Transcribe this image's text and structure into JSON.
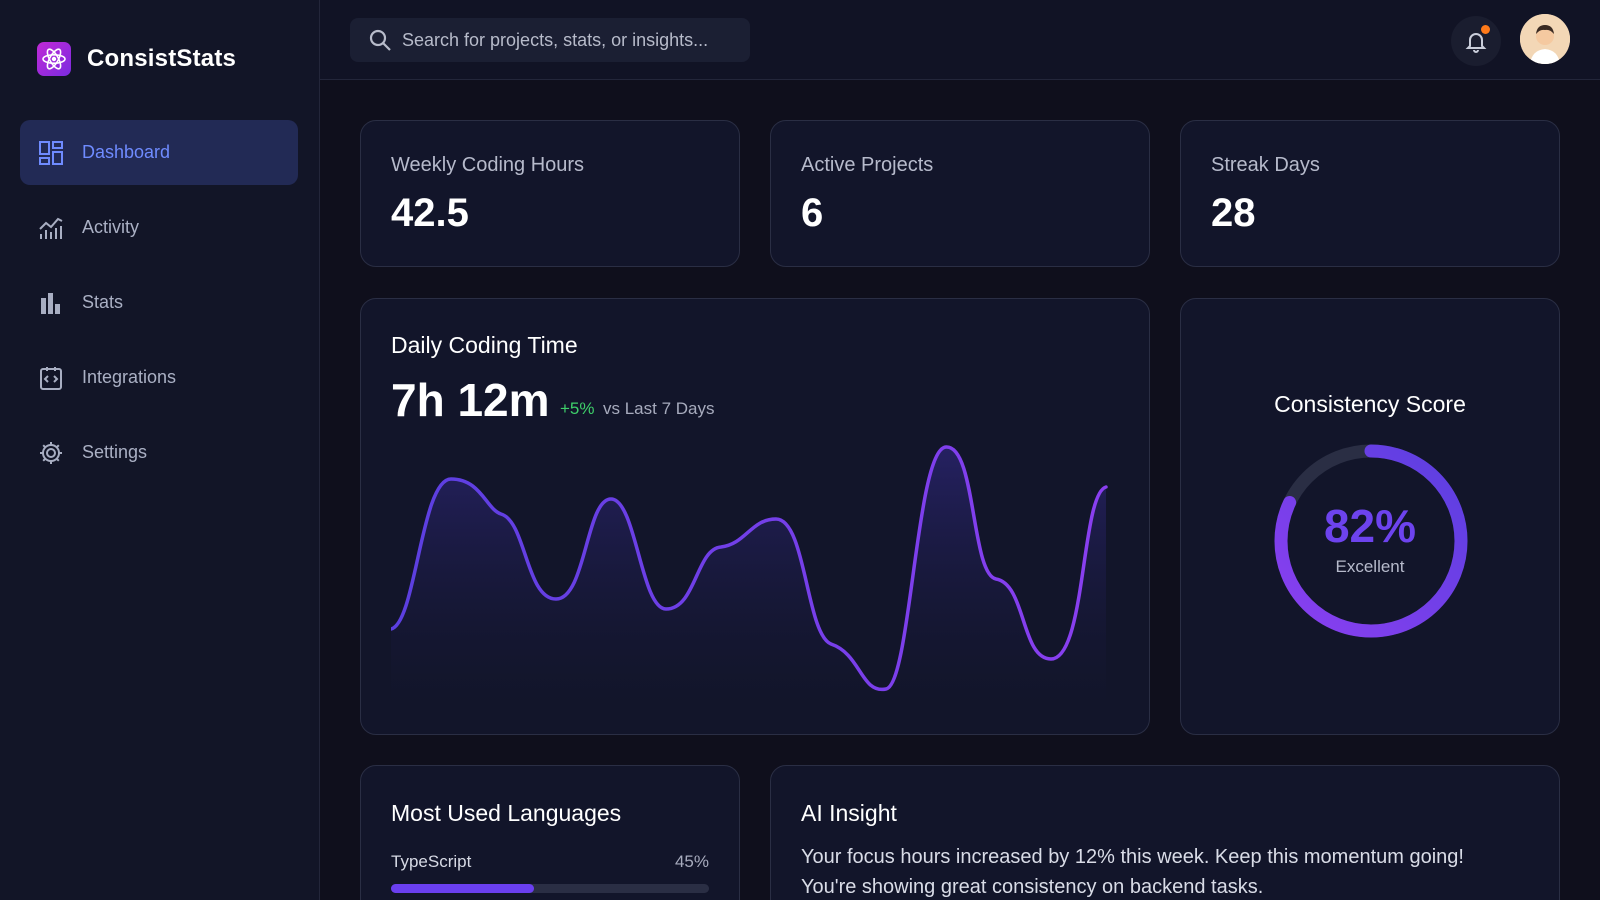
{
  "brand": {
    "name": "ConsistStats",
    "logo_icon": "atom-icon"
  },
  "sidebar": {
    "items": [
      {
        "label": "Dashboard",
        "icon": "dashboard-icon",
        "active": true
      },
      {
        "label": "Activity",
        "icon": "activity-chart-icon",
        "active": false
      },
      {
        "label": "Stats",
        "icon": "bar-chart-icon",
        "active": false
      },
      {
        "label": "Integrations",
        "icon": "code-clipboard-icon",
        "active": false
      },
      {
        "label": "Settings",
        "icon": "gear-icon",
        "active": false
      }
    ]
  },
  "header": {
    "search_placeholder": "Search for projects, stats, or insights...",
    "notification_icon": "bell-icon",
    "avatar_icon": "user-avatar-icon"
  },
  "stats": [
    {
      "label": "Weekly Coding Hours",
      "value": "42.5"
    },
    {
      "label": "Active Projects",
      "value": "6"
    },
    {
      "label": "Streak Days",
      "value": "28"
    }
  ],
  "daily_chart": {
    "title": "Daily Coding Time",
    "total": "7h 12m",
    "change": "+5%",
    "comparison": "vs Last 7 Days"
  },
  "consistency": {
    "title": "Consistency Score",
    "value": "82%",
    "percent": 82,
    "label": "Excellent"
  },
  "languages": {
    "title": "Most Used Languages",
    "items": [
      {
        "name": "TypeScript",
        "percent_label": "45%",
        "percent": 45
      }
    ]
  },
  "insight": {
    "title": "AI Insight",
    "text": "Your focus hours increased by 12% this week. Keep this momentum going! You're showing great consistency on backend tasks."
  },
  "colors": {
    "accent": "#6f8bff",
    "purple": "#6a3ff0",
    "positive": "#3ecf6a",
    "notification": "#ff7a1a"
  }
}
